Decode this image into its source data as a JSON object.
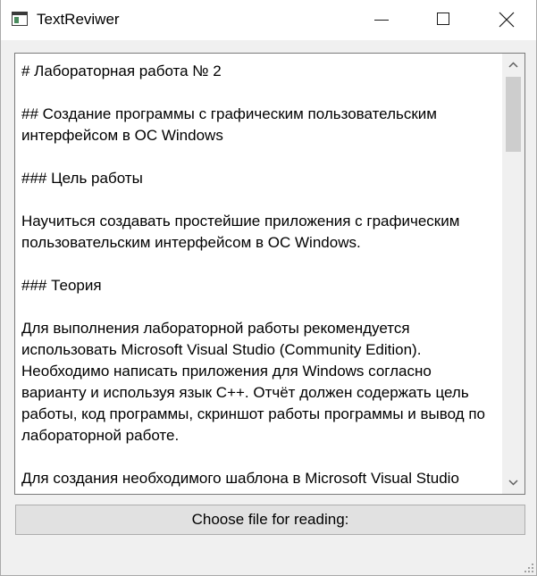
{
  "window": {
    "title": "TextReviwer",
    "app_icon": "window-app-icon",
    "controls": {
      "minimize_icon": "minimize-icon",
      "maximize_icon": "maximize-icon",
      "close_icon": "close-icon"
    }
  },
  "document": {
    "paragraphs": [
      "# Лабораторная работа № 2",
      "## Создание программы с графическим пользовательским интерфейсом в ОС Windows",
      "### Цель работы",
      "Научиться создавать простейшие приложения с графическим пользовательским интерфейсом в ОС Windows.",
      "### Теория",
      "Для выполнения лабораторной работы рекомендуется использовать Microsoft Visual Studio (Community Edition). Необходимо написать приложения для Windows согласно варианту и используя язык C++. Отчёт должен содержать цель работы, код программы, скриншот работы программы и вывод по лабораторной работе.",
      "Для создания необходимого шаблона в Microsoft Visual Studio"
    ]
  },
  "scrollbar": {
    "up_icon": "scroll-up-arrow-icon",
    "down_icon": "scroll-down-arrow-icon",
    "position_fraction": 0.0
  },
  "actions": {
    "choose_file_label": "Choose file for reading:"
  },
  "colors": {
    "titlebar": "#ffffff",
    "window_bg": "#f0f0f0",
    "button_bg": "#e1e1e1",
    "button_border": "#adadad",
    "scroll_thumb": "#cdcdcd"
  }
}
